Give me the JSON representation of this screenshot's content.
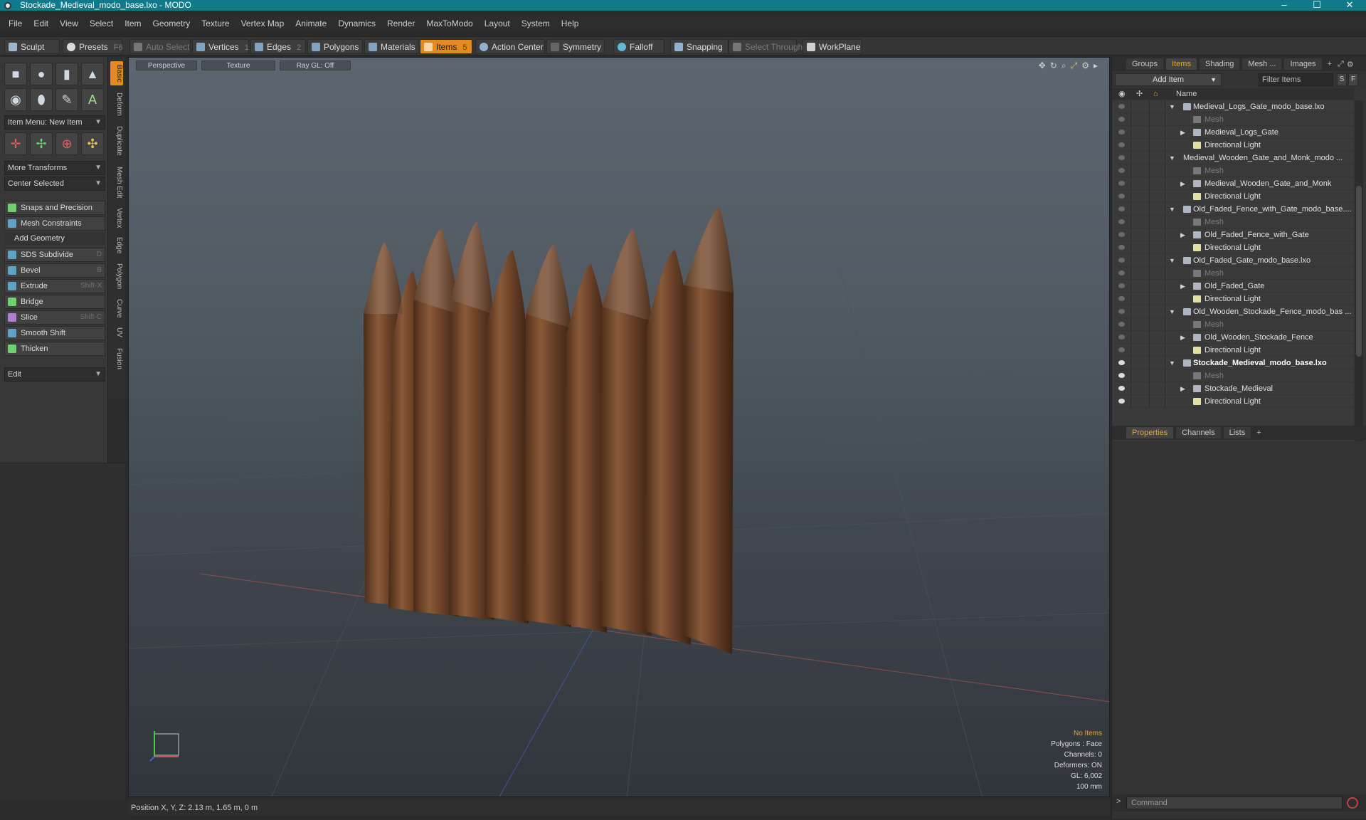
{
  "window": {
    "title": "Stockade_Medieval_modo_base.lxo - MODO",
    "controls": [
      "–",
      "☐",
      "✕"
    ]
  },
  "menu": [
    "File",
    "Edit",
    "View",
    "Select",
    "Item",
    "Geometry",
    "Texture",
    "Vertex Map",
    "Animate",
    "Dynamics",
    "Render",
    "MaxToModo",
    "Layout",
    "System",
    "Help"
  ],
  "toolbar": {
    "sculpt": "Sculpt",
    "presets": "Presets",
    "presets_key": "F6",
    "auto_select": "Auto Select",
    "vertices": "Vertices",
    "vertices_key": "1",
    "edges": "Edges",
    "edges_key": "2",
    "polygons": "Polygons",
    "materials": "Materials",
    "items": "Items",
    "items_key": "5",
    "action_center": "Action Center",
    "symmetry": "Symmetry",
    "falloff": "Falloff",
    "snapping": "Snapping",
    "select_through": "Select Through",
    "workplane": "WorkPlane"
  },
  "left": {
    "item_menu": "Item Menu: New Item",
    "more_transforms": "More Transforms",
    "center_selected": "Center Selected",
    "snaps": "Snaps and Precision",
    "mesh_constraints": "Mesh Constraints",
    "add_geometry": "Add Geometry",
    "tools": [
      {
        "label": "SDS Subdivide",
        "key": "D"
      },
      {
        "label": "Bevel",
        "key": "B"
      },
      {
        "label": "Extrude",
        "key": "Shift-X"
      },
      {
        "label": "Bridge",
        "key": ""
      },
      {
        "label": "Slice",
        "key": "Shift-C"
      },
      {
        "label": "Smooth Shift",
        "key": ""
      },
      {
        "label": "Thicken",
        "key": ""
      }
    ],
    "edit": "Edit",
    "side_tabs": [
      "Basic",
      "Deform",
      "Duplicate",
      "Mesh Edit",
      "Vertex",
      "Edge",
      "Polygon",
      "Curve",
      "UV",
      "Fusion"
    ]
  },
  "viewport": {
    "perspective": "Perspective",
    "texture": "Texture",
    "raygl": "Ray GL: Off",
    "info": {
      "no_items": "No Items",
      "polygons": "Polygons : Face",
      "channels": "Channels: 0",
      "deformers": "Deformers: ON",
      "gl": "GL: 6,002",
      "scale": "100 mm"
    }
  },
  "status": {
    "position": "Position X, Y, Z:  2.13 m, 1.65 m, 0 m"
  },
  "right": {
    "tabs": [
      "Groups",
      "Items",
      "Shading",
      "Mesh ...",
      "Images"
    ],
    "add_item": "Add Item",
    "filter_items": "Filter Items",
    "s_btn": "S",
    "f_btn": "F",
    "col_name": "Name",
    "tree": [
      {
        "label": "Medieval_Logs_Gate_modo_base.lxo",
        "type": "scene"
      },
      {
        "label": "Mesh",
        "type": "mesh"
      },
      {
        "label": "Medieval_Logs_Gate",
        "type": "group"
      },
      {
        "label": "Directional Light",
        "type": "light"
      },
      {
        "label": "Medieval_Wooden_Gate_and_Monk_modo ...",
        "type": "scene"
      },
      {
        "label": "Mesh",
        "type": "mesh"
      },
      {
        "label": "Medieval_Wooden_Gate_and_Monk",
        "type": "group"
      },
      {
        "label": "Directional Light",
        "type": "light"
      },
      {
        "label": "Old_Faded_Fence_with_Gate_modo_base....",
        "type": "scene"
      },
      {
        "label": "Mesh",
        "type": "mesh"
      },
      {
        "label": "Old_Faded_Fence_with_Gate",
        "type": "group"
      },
      {
        "label": "Directional Light",
        "type": "light"
      },
      {
        "label": "Old_Faded_Gate_modo_base.lxo",
        "type": "scene"
      },
      {
        "label": "Mesh",
        "type": "mesh"
      },
      {
        "label": "Old_Faded_Gate",
        "type": "group"
      },
      {
        "label": "Directional Light",
        "type": "light"
      },
      {
        "label": "Old_Wooden_Stockade_Fence_modo_bas ...",
        "type": "scene"
      },
      {
        "label": "Mesh",
        "type": "mesh"
      },
      {
        "label": "Old_Wooden_Stockade_Fence",
        "type": "group"
      },
      {
        "label": "Directional Light",
        "type": "light"
      },
      {
        "label": "Stockade_Medieval_modo_base.lxo",
        "type": "scene",
        "bold": true
      },
      {
        "label": "Mesh",
        "type": "mesh"
      },
      {
        "label": "Stockade_Medieval",
        "type": "group"
      },
      {
        "label": "Directional Light",
        "type": "light"
      }
    ],
    "prop_tabs": [
      "Properties",
      "Channels",
      "Lists"
    ],
    "command_placeholder": "Command"
  },
  "colors": {
    "titlebar": "#0f7b8a",
    "accent": "#e38b1e"
  }
}
